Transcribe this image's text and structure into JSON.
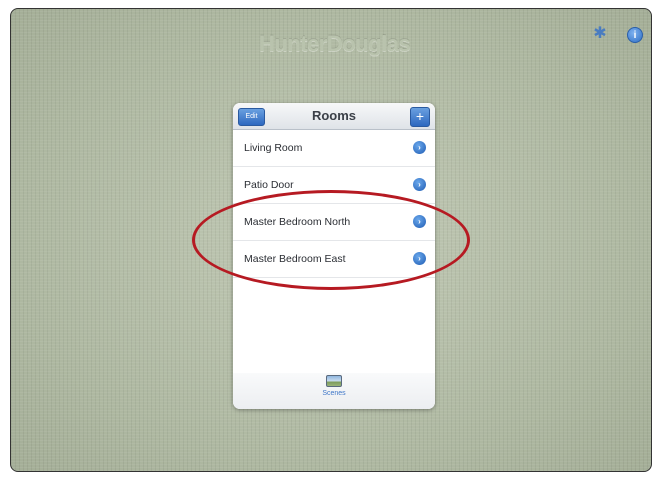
{
  "header": {
    "brand": "HunterDouglas",
    "settings_icon": "gear-icon",
    "help_icon": "info-icon",
    "help_glyph": "i"
  },
  "panel": {
    "title": "Rooms",
    "edit_label": "Edit",
    "add_label": "+",
    "rooms": [
      {
        "label": "Living Room",
        "icon": "chevron-right-icon"
      },
      {
        "label": "Patio Door",
        "icon": "chevron-right-icon"
      },
      {
        "label": "Master Bedroom North",
        "icon": "chevron-right-icon"
      },
      {
        "label": "Master Bedroom East",
        "icon": "chevron-right-icon"
      }
    ],
    "disclosure_glyph": "›"
  },
  "tabbar": {
    "scenes_label": "Scenes",
    "scenes_icon": "image-icon"
  },
  "colors": {
    "accent_blue": "#2d68c0",
    "background": "#b3bca6",
    "annotation_red": "#b61a22"
  }
}
